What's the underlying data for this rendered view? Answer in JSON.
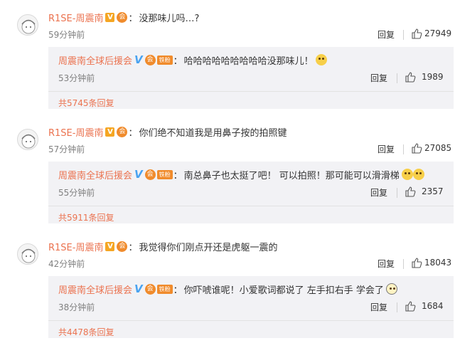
{
  "comments": [
    {
      "user": "R1SE-周震南",
      "colon": "：",
      "text": "没那味儿吗…?",
      "time": "59分钟前",
      "reply_label": "回复",
      "likes": "27949",
      "sub": {
        "user": "周震南全球后援会",
        "fan_badge": "铁粉",
        "colon": "：",
        "text": "哈哈哈哈哈哈哈哈哈没那味儿！",
        "emoji": "thinking-face",
        "time": "53分钟前",
        "reply_label": "回复",
        "likes": "1989"
      },
      "more": "共5745条回复"
    },
    {
      "user": "R1SE-周震南",
      "colon": "：",
      "text": "你们绝不知道我是用鼻子按的拍照键",
      "time": "57分钟前",
      "reply_label": "回复",
      "likes": "27085",
      "sub": {
        "user": "周震南全球后援会",
        "fan_badge": "铁粉",
        "colon": "：",
        "text": "南总鼻子也太挺了吧！ 可以拍照！那可能可以滑滑梯",
        "emoji": "screaming-faces",
        "time": "55分钟前",
        "reply_label": "回复",
        "likes": "2357"
      },
      "more": "共5911条回复"
    },
    {
      "user": "R1SE-周震南",
      "colon": "：",
      "text": "我觉得你们刚点开还是虎躯一震的",
      "time": "42分钟前",
      "reply_label": "回复",
      "likes": "18043",
      "sub": {
        "user": "周震南全球后援会",
        "fan_badge": "铁粉",
        "colon": "：",
        "text": "你吓唬谁呢！小爱歌词都说了 左手扣右手 学会了",
        "emoji": "glasses-face",
        "time": "38分钟前",
        "reply_label": "回复",
        "likes": "1684"
      },
      "more": "共4478条回复"
    }
  ],
  "colors": {
    "username": "#eb7350",
    "more_link": "#eb7350",
    "sub_bg": "#f2f2f5",
    "time": "#808080"
  }
}
